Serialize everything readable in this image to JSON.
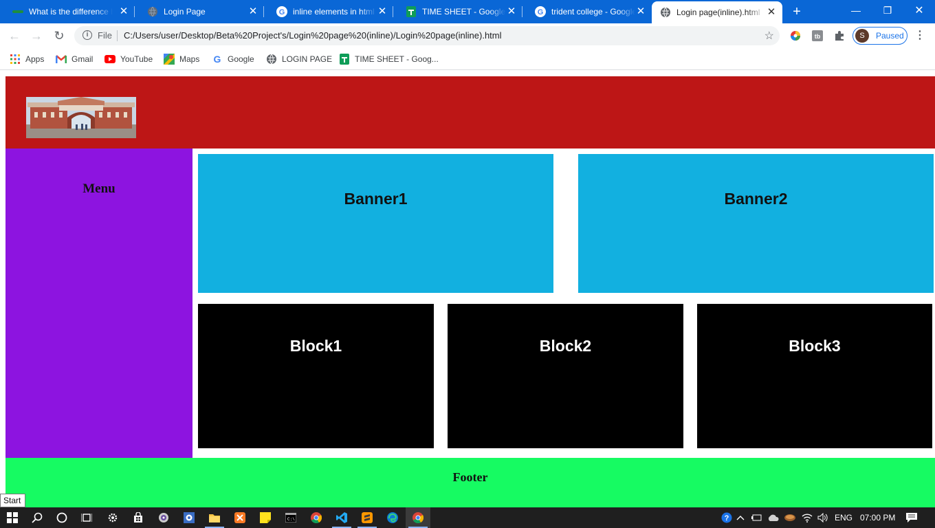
{
  "browser": {
    "tabs": [
      {
        "title": "What is the difference b",
        "icon": "sheets-green-icon",
        "active": false
      },
      {
        "title": "Login Page",
        "icon": "globe-icon",
        "active": false
      },
      {
        "title": "inline elements in html",
        "icon": "google-icon",
        "active": false
      },
      {
        "title": "TIME SHEET - Google Sh",
        "icon": "sheets-icon",
        "active": false
      },
      {
        "title": "trident college - Google",
        "icon": "google-icon",
        "active": false
      },
      {
        "title": "Login page(inline).html",
        "icon": "globe-icon",
        "active": true
      }
    ],
    "new_tab": "+",
    "address": {
      "scheme": "File",
      "url": "C:/Users/user/Desktop/Beta%20Project's/Login%20page%20(inline)/Login%20page(inline).html"
    },
    "profile": {
      "initial": "S",
      "status": "Paused"
    },
    "bookmarks": [
      {
        "label": "Apps",
        "icon": "apps-grid-icon"
      },
      {
        "label": "Gmail",
        "icon": "gmail-icon"
      },
      {
        "label": "YouTube",
        "icon": "youtube-icon"
      },
      {
        "label": "Maps",
        "icon": "maps-icon"
      },
      {
        "label": "Google",
        "icon": "google-icon"
      },
      {
        "label": "LOGIN PAGE",
        "icon": "globe-icon"
      },
      {
        "label": "TIME SHEET - Goog...",
        "icon": "sheets-icon"
      }
    ]
  },
  "page": {
    "colors": {
      "header": "#bd1616",
      "menu": "#8d14e0",
      "banner": "#12b0e0",
      "block": "#000000",
      "footer": "#16fb62"
    },
    "menu_title": "Menu",
    "banners": [
      "Banner1",
      "Banner2"
    ],
    "blocks": [
      "Block1",
      "Block2",
      "Block3"
    ],
    "footer_text": "Footer"
  },
  "taskbar": {
    "start_tooltip": "Start",
    "language": "ENG",
    "time": "07:00 PM"
  }
}
